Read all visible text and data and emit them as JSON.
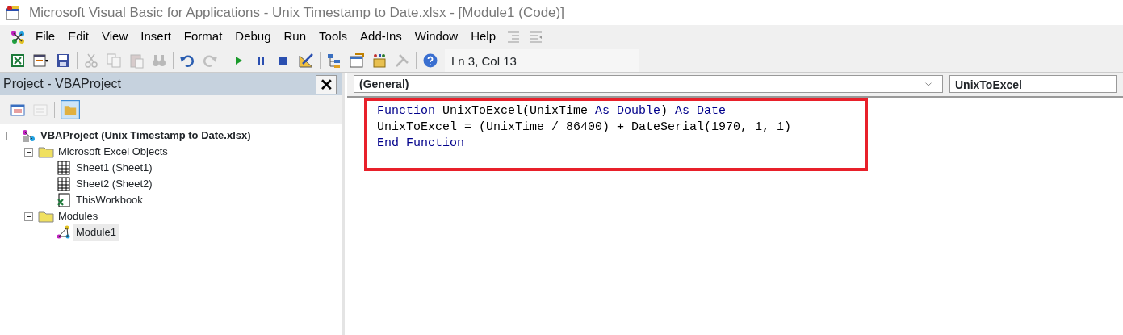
{
  "window": {
    "title": "Microsoft Visual Basic for Applications - Unix Timestamp to Date.xlsx - [Module1 (Code)]"
  },
  "menu": [
    "File",
    "Edit",
    "View",
    "Insert",
    "Format",
    "Debug",
    "Run",
    "Tools",
    "Add-Ins",
    "Window",
    "Help"
  ],
  "toolbar": [
    {
      "kind": "excel",
      "disabled": false
    },
    {
      "kind": "form",
      "disabled": false
    },
    {
      "kind": "save",
      "disabled": false
    },
    {
      "kind": "sep"
    },
    {
      "kind": "cut",
      "disabled": true
    },
    {
      "kind": "copy",
      "disabled": true
    },
    {
      "kind": "paste",
      "disabled": true
    },
    {
      "kind": "find",
      "disabled": true
    },
    {
      "kind": "sep"
    },
    {
      "kind": "undo",
      "disabled": false
    },
    {
      "kind": "redo",
      "disabled": true
    },
    {
      "kind": "sep"
    },
    {
      "kind": "run",
      "disabled": false
    },
    {
      "kind": "pause",
      "disabled": false
    },
    {
      "kind": "stop",
      "disabled": false
    },
    {
      "kind": "design",
      "disabled": false
    },
    {
      "kind": "sep"
    },
    {
      "kind": "explorer",
      "disabled": false
    },
    {
      "kind": "properties",
      "disabled": false
    },
    {
      "kind": "browser",
      "disabled": false
    },
    {
      "kind": "tools",
      "disabled": true
    },
    {
      "kind": "sep"
    },
    {
      "kind": "help",
      "disabled": false
    }
  ],
  "status": "Ln 3, Col 13",
  "project": {
    "title": "Project - VBAProject",
    "close": "✕",
    "tree": [
      {
        "label": "VBAProject (Unix Timestamp to Date.xlsx)",
        "kind": "project",
        "expanded": true,
        "selected": false,
        "children": [
          {
            "label": "Microsoft Excel Objects",
            "kind": "folder",
            "expanded": true,
            "selected": false,
            "children": [
              {
                "label": "Sheet1 (Sheet1)",
                "kind": "sheet",
                "selected": false
              },
              {
                "label": "Sheet2 (Sheet2)",
                "kind": "sheet",
                "selected": false
              },
              {
                "label": "ThisWorkbook",
                "kind": "workbook",
                "selected": false
              }
            ]
          },
          {
            "label": "Modules",
            "kind": "folder",
            "expanded": true,
            "selected": false,
            "children": [
              {
                "label": "Module1",
                "kind": "module",
                "selected": true
              }
            ]
          }
        ]
      }
    ]
  },
  "code": {
    "object": "(General)",
    "procedure": "UnixToExcel",
    "lines": [
      [
        {
          "text": "Function",
          "kind": "keyword"
        },
        {
          "text": " UnixToExcel(UnixTime ",
          "kind": "plain"
        },
        {
          "text": "As Double",
          "kind": "keyword"
        },
        {
          "text": ") ",
          "kind": "plain"
        },
        {
          "text": "As Date",
          "kind": "keyword"
        }
      ],
      [
        {
          "text": "UnixToExcel = (UnixTime / 86400) + DateSerial(1970, 1, 1)",
          "kind": "plain"
        }
      ],
      [
        {
          "text": "End Function",
          "kind": "keyword"
        }
      ]
    ]
  }
}
